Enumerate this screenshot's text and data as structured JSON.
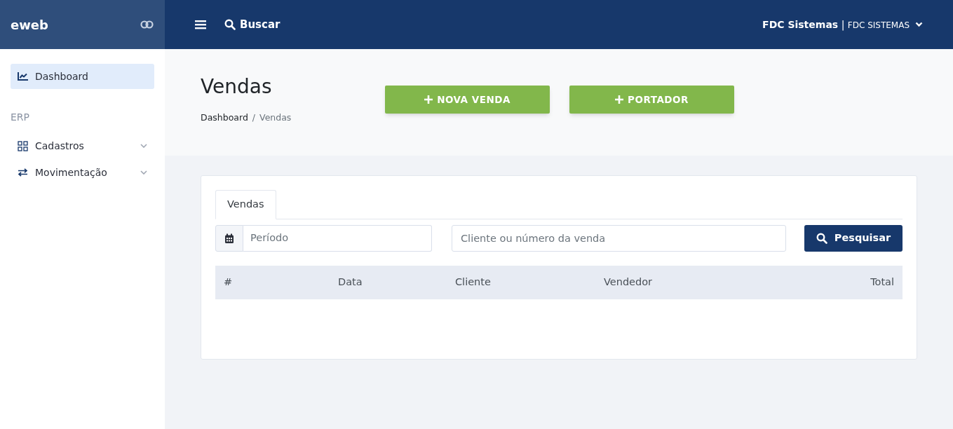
{
  "sidebar": {
    "logo": "eweb",
    "sections": [
      {
        "items": [
          {
            "label": "Dashboard",
            "kind": "chart",
            "selected": true
          }
        ]
      },
      {
        "heading": "ERP",
        "items": [
          {
            "label": "Cadastros",
            "kind": "grid",
            "selected": false,
            "expanded": false
          },
          {
            "label": "Movimentação",
            "kind": "arrows",
            "selected": false,
            "expanded": false
          }
        ]
      }
    ]
  },
  "topbar": {
    "search_label": "Buscar",
    "company": "FDC Sistemas",
    "separator": "|",
    "company_detail": "FDC SISTEMAS"
  },
  "page": {
    "title": "Vendas",
    "breadcrumb_separator": "/",
    "breadcrumb": [
      {
        "label": "Dashboard"
      },
      {
        "label": "Vendas"
      }
    ],
    "actions": [
      "NOVA VENDA",
      "PORTADOR"
    ]
  },
  "card": {
    "tabs": [
      {
        "label": "Vendas",
        "selected": true
      }
    ],
    "period_field": {
      "placeholder": "Período"
    },
    "search_field": {
      "placeholder": "Cliente ou número da venda"
    },
    "search_button": "Pesquisar",
    "table": {
      "columns": [
        "#",
        "Data",
        "Cliente",
        "Vendedor",
        "Total"
      ]
    }
  }
}
